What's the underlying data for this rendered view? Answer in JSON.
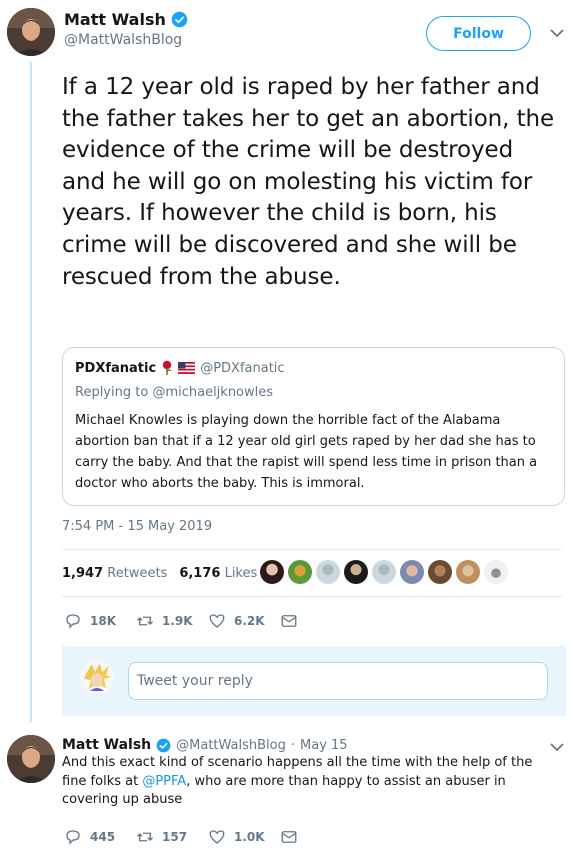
{
  "main_tweet": {
    "author_name": "Matt Walsh",
    "author_handle": "@MattWalshBlog",
    "follow_label": "Follow",
    "text": "If a 12 year old is raped by her father and the father takes her to get an abortion, the evidence of the crime will be destroyed and he will go on molesting his victim for years. If however the child is born, his crime will be discovered and she will be rescued from the abuse.",
    "timestamp": "7:54 PM - 15 May 2019",
    "retweets_count": "1,947",
    "retweets_label": "Retweets",
    "likes_count": "6,176",
    "likes_label": "Likes",
    "reply_count": "18K",
    "retweet_action_count": "1.9K",
    "like_action_count": "6.2K"
  },
  "quoted_tweet": {
    "author_name": "PDXfanatic",
    "author_handle": "@PDXfanatic",
    "replying_prefix": "Replying to",
    "replying_to": "@michaeljknowles",
    "text": "Michael Knowles is playing down the horrible fact of the Alabama abortion ban that if a 12 year old girl gets raped by her dad she has to carry the baby. And that the rapist will spend less time in prison than a doctor who aborts the baby. This is immoral."
  },
  "reply_composer": {
    "placeholder": "Tweet your reply"
  },
  "reply_tweet": {
    "author_name": "Matt Walsh",
    "author_handle": "@MattWalshBlog",
    "separator": "·",
    "date": "May 15",
    "text_before": "And this exact kind of scenario happens all the time with the help of the fine folks at ",
    "mention": "@PPFA",
    "text_after": ", who are more than happy to assist an abuser in covering up abuse",
    "reply_count": "445",
    "retweet_count": "157",
    "like_count": "1.0K"
  },
  "colors": {
    "accent": "#1da1f2",
    "muted": "#657786",
    "text": "#14171a",
    "thread_line": "#c4e4f9",
    "reply_bg": "#e8f5fd"
  },
  "icons": [
    "verified-badge-icon",
    "chevron-down-icon",
    "rose-icon",
    "us-flag-icon",
    "reply-icon",
    "retweet-icon",
    "like-heart-icon",
    "direct-message-icon"
  ]
}
